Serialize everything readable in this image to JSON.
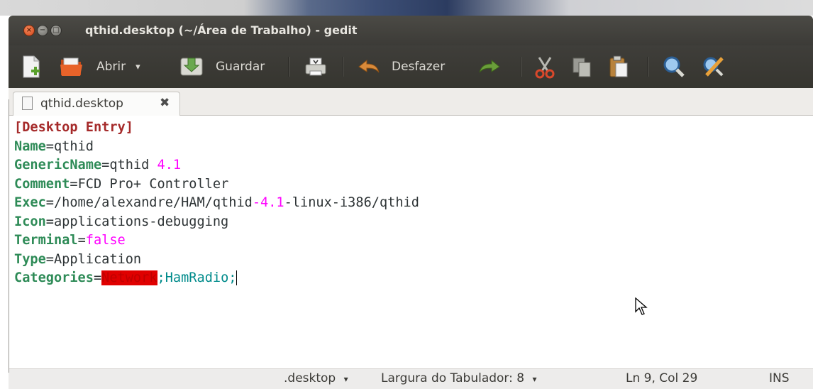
{
  "window": {
    "title": "qthid.desktop (~/Área de Trabalho) - gedit",
    "buttons": {
      "close": "×",
      "minimize": "−",
      "maximize": "□"
    }
  },
  "toolbar": {
    "open_label": "Abrir",
    "open_dropdown": "▾",
    "save_label": "Guardar",
    "undo_label": "Desfazer"
  },
  "tabs": [
    {
      "label": "qthid.desktop",
      "close": "✖"
    }
  ],
  "document": {
    "lines": [
      {
        "segments": [
          {
            "text": "[Desktop Entry]",
            "style": "hdr"
          }
        ]
      },
      {
        "segments": [
          {
            "text": "Name",
            "style": "key"
          },
          {
            "text": "=qthid",
            "style": "plain"
          }
        ]
      },
      {
        "segments": [
          {
            "text": "GenericName",
            "style": "key"
          },
          {
            "text": "=qthid ",
            "style": "plain"
          },
          {
            "text": "4.1",
            "style": "num"
          }
        ]
      },
      {
        "segments": [
          {
            "text": "Comment",
            "style": "key"
          },
          {
            "text": "=FCD Pro+ Controller",
            "style": "plain"
          }
        ]
      },
      {
        "segments": [
          {
            "text": "Exec",
            "style": "key"
          },
          {
            "text": "=/home/alexandre/HAM/qthid",
            "style": "plain"
          },
          {
            "text": "-4.1",
            "style": "num"
          },
          {
            "text": "-linux-i386/qthid",
            "style": "plain"
          }
        ]
      },
      {
        "segments": [
          {
            "text": "Icon",
            "style": "key"
          },
          {
            "text": "=applications-debugging",
            "style": "plain"
          }
        ]
      },
      {
        "segments": [
          {
            "text": "Terminal",
            "style": "key"
          },
          {
            "text": "=",
            "style": "plain"
          },
          {
            "text": "false",
            "style": "kw"
          }
        ]
      },
      {
        "segments": [
          {
            "text": "Type",
            "style": "key"
          },
          {
            "text": "=Application",
            "style": "plain"
          }
        ]
      },
      {
        "segments": [
          {
            "text": "Categories",
            "style": "key"
          },
          {
            "text": "=",
            "style": "plain"
          },
          {
            "text": "Network",
            "style": "err"
          },
          {
            "text": ";HamRadio;",
            "style": "teal"
          }
        ],
        "caret": true
      }
    ]
  },
  "statusbar": {
    "language": ".desktop",
    "language_dropdown": "▾",
    "tab_width": "Largura do Tabulador: 8",
    "tab_width_dropdown": "▾",
    "position": "Ln 9, Col 29",
    "mode": "INS"
  },
  "colors": {
    "header": "#a52a2a",
    "key": "#2e8b57",
    "number": "#ff00ff",
    "error_bg": "#e00000",
    "teal": "#008b8b",
    "toolbar_bg": "#3c3b37"
  }
}
